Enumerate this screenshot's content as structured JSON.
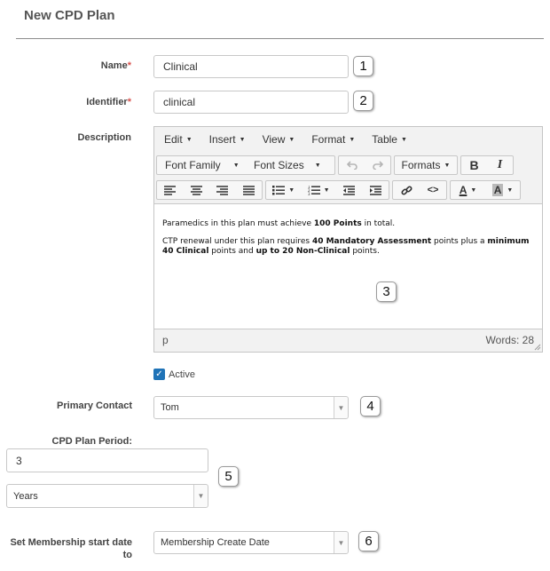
{
  "page": {
    "title": "New CPD Plan"
  },
  "fields": {
    "name": {
      "label": "Name",
      "required_mark": "*",
      "value": "Clinical"
    },
    "identifier": {
      "label": "Identifier",
      "required_mark": "*",
      "value": "clinical"
    },
    "description": {
      "label": "Description"
    },
    "active": {
      "label": "Active",
      "checked": true
    },
    "primary_contact": {
      "label": "Primary Contact",
      "value": "Tom"
    },
    "plan_period": {
      "label": "CPD Plan Period:",
      "value": "3",
      "unit": "Years"
    },
    "membership_start": {
      "label_line1": "Set Membership start date",
      "label_line2": "to",
      "value": "Membership Create Date"
    }
  },
  "editor": {
    "menus": [
      "Edit",
      "Insert",
      "View",
      "Format",
      "Table"
    ],
    "toolbar": {
      "font_family": "Font Family",
      "font_sizes": "Font Sizes",
      "formats": "Formats",
      "bold": "B",
      "italic": "I",
      "font_color": "A",
      "bg_color": "A"
    },
    "content": {
      "p1": {
        "pre": "Paramedics in this plan must achieve ",
        "bold1": "100 Points",
        "post": " in total."
      },
      "p2": {
        "t1": "CTP renewal under this plan requires ",
        "b1": "40 Mandatory Assessment",
        "t2": " points plus a ",
        "b2": "minimum 40 Clinical",
        "t3": " points and ",
        "b3": "up to 20 Non-Clinical",
        "t4": " points."
      }
    },
    "status": {
      "path": "p",
      "words": "Words: 28"
    }
  },
  "callouts": [
    "1",
    "2",
    "3",
    "4",
    "5",
    "6"
  ],
  "colors": {
    "accent": "#1f73b7",
    "required": "#d9534f"
  }
}
